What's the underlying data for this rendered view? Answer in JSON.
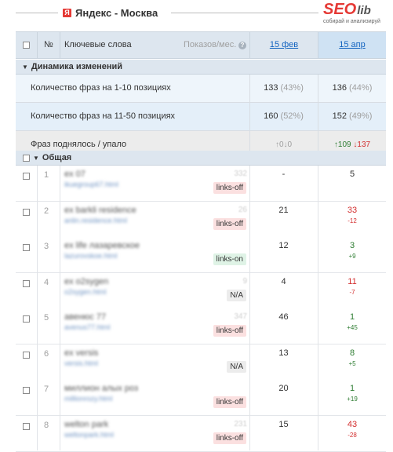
{
  "header": {
    "engine_icon": "Я",
    "title": "Яндекс -  Москва",
    "logo_seo": "SEO",
    "logo_lib": "lib",
    "logo_tagline": "собирай и анализируй"
  },
  "table_header": {
    "num_label": "№",
    "keywords_label": "Ключевые слова",
    "shows_label": "Показов/мес.",
    "help_icon": "?",
    "date1": "15 фев",
    "date2": "15 апр"
  },
  "dynamics": {
    "title": "Динамика изменений",
    "rows": [
      {
        "label": "Количество фраз на 1-10 позициях",
        "v1": "133",
        "v1_pct": "(43%)",
        "v2": "136",
        "v2_pct": "(44%)"
      },
      {
        "label": "Количество фраз на 11-50 позициях",
        "v1": "160",
        "v1_pct": "(52%)",
        "v2": "152",
        "v2_pct": "(49%)"
      },
      {
        "label": "Фраз поднялось / упало",
        "v1_up": "↑0",
        "v1_down": "↓0",
        "v2_up": "↑109",
        "v2_down": "↓137"
      }
    ]
  },
  "general": {
    "title": "Общая",
    "rows": [
      {
        "num": "1",
        "kw": "ex 07",
        "kw_sub": "ikuegroup67.html",
        "count": "332",
        "tag": "links-off",
        "p1": "-",
        "p2": "5",
        "d2": ""
      },
      {
        "num": "2",
        "kw": "ex barkli residence",
        "kw_sub": "anlin.residence.html",
        "count": "26",
        "tag": "links-off",
        "p1": "21",
        "p2": "33",
        "d2": "-12"
      },
      {
        "num": "3",
        "kw": "ex life лазаревское",
        "kw_sub": "lazurovskoe.html",
        "count": "",
        "tag": "links-on",
        "p1": "12",
        "p2": "3",
        "d2": "+9"
      },
      {
        "num": "4",
        "kw": "ex o2sygen",
        "kw_sub": "o2sygen.html",
        "count": "9",
        "tag": "N/A",
        "p1": "4",
        "p2": "11",
        "d2": "-7"
      },
      {
        "num": "5",
        "kw": "авенюс 77",
        "kw_sub": "avenus77.html",
        "count": "347",
        "tag": "links-off",
        "p1": "46",
        "p2": "1",
        "d2": "+45"
      },
      {
        "num": "6",
        "kw": "ex versis",
        "kw_sub": "versis.html",
        "count": "",
        "tag": "N/A",
        "p1": "13",
        "p2": "8",
        "d2": "+5"
      },
      {
        "num": "7",
        "kw": "миллион алых роз",
        "kw_sub": "millionrozy.html",
        "count": "",
        "tag": "links-off",
        "p1": "20",
        "p2": "1",
        "d2": "+19"
      },
      {
        "num": "8",
        "kw": "welton park",
        "kw_sub": "weltonpark.html",
        "count": "231",
        "tag": "links-off",
        "p1": "15",
        "p2": "43",
        "d2": "-28"
      }
    ]
  },
  "colors": {
    "accent": "#1565c0",
    "header_bg": "#dde6ef",
    "up": "#2e7d32",
    "down": "#d32f2f"
  }
}
